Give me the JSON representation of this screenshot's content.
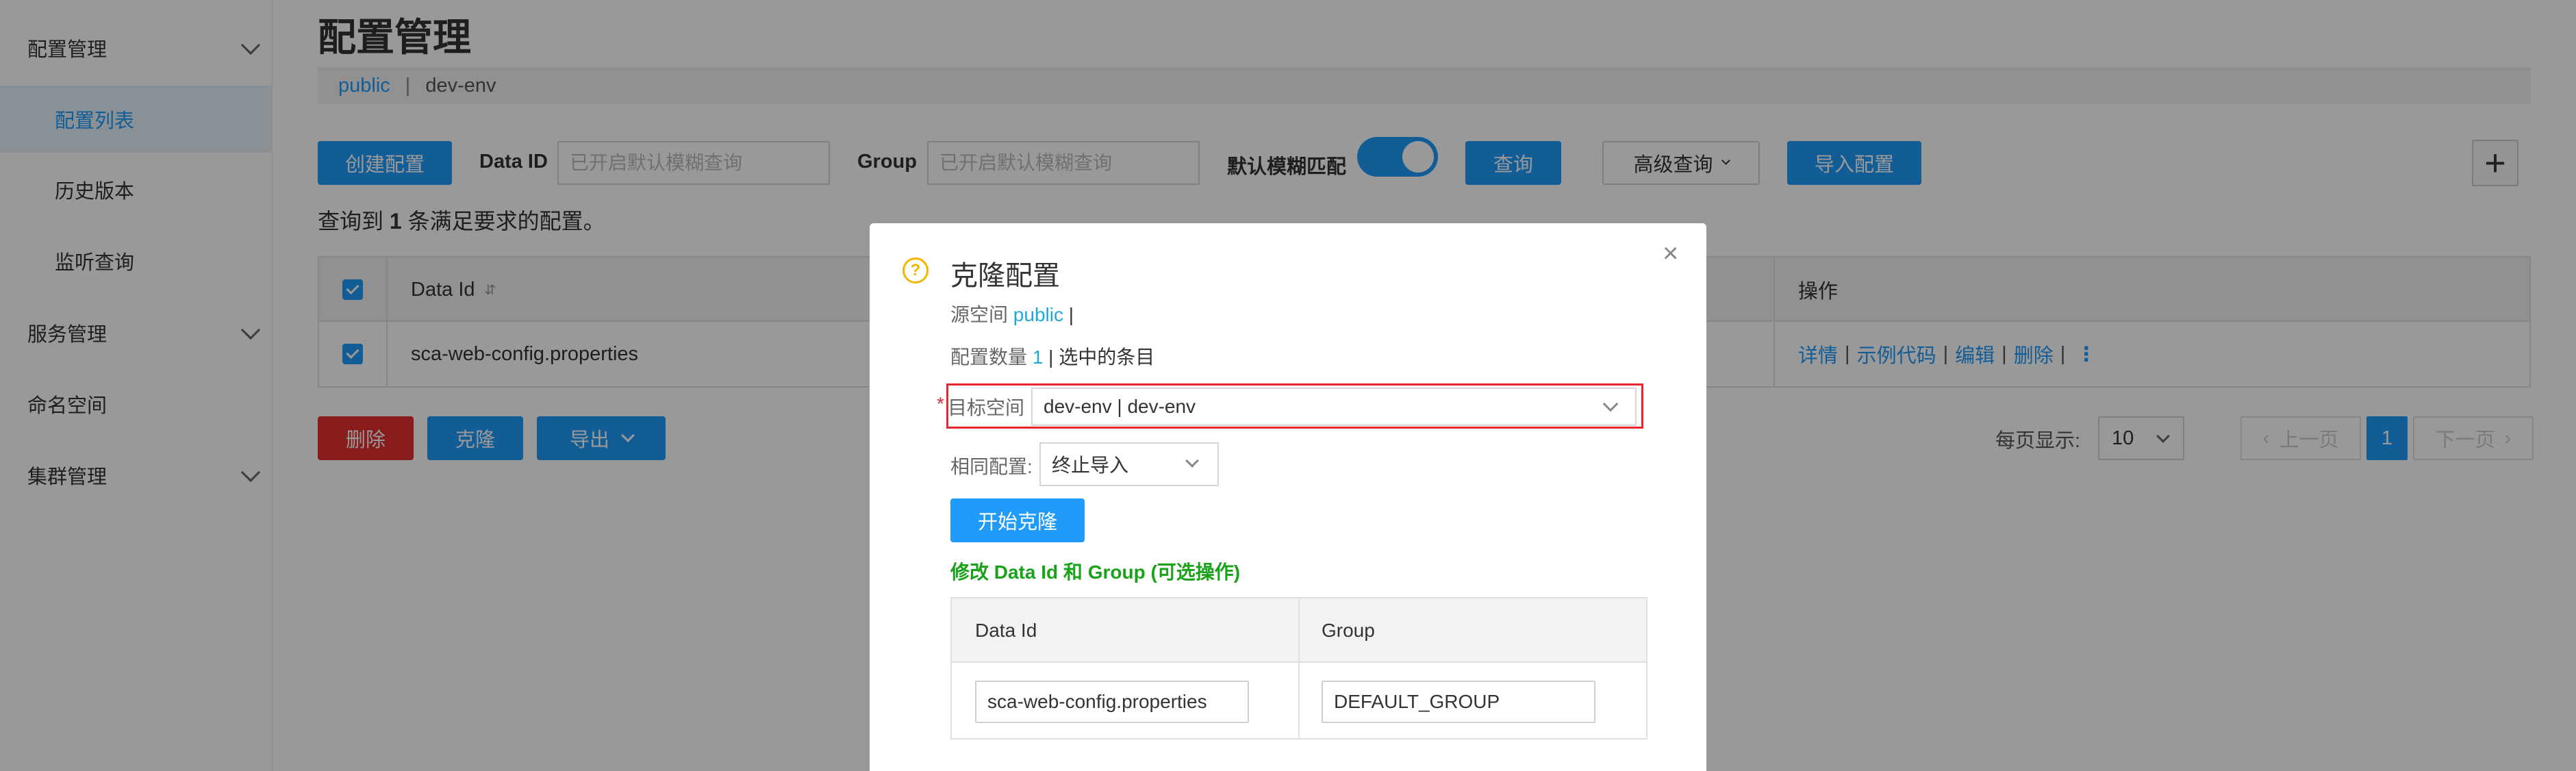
{
  "sidebar": {
    "groups": [
      {
        "label": "配置管理"
      },
      {
        "label": "服务管理"
      },
      {
        "label": "命名空间"
      },
      {
        "label": "集群管理"
      }
    ],
    "items": [
      {
        "label": "配置列表"
      },
      {
        "label": "历史版本"
      },
      {
        "label": "监听查询"
      }
    ]
  },
  "header": {
    "title": "配置管理",
    "breadcrumb": {
      "link": "public",
      "separator": "|",
      "current": "dev-env"
    }
  },
  "toolbar": {
    "create_label": "创建配置",
    "dataid_label": "Data ID",
    "dataid_placeholder": "已开启默认模糊查询",
    "group_label": "Group",
    "group_placeholder": "已开启默认模糊查询",
    "fuzzy_label": "默认模糊匹配",
    "fuzzy_on": true,
    "query_label": "查询",
    "advanced_label": "高级查询",
    "import_label": "导入配置",
    "plus": "+"
  },
  "result": {
    "prefix": "查询到",
    "count": "1",
    "suffix": "条满足要求的配置。"
  },
  "table": {
    "headers": {
      "dataid": "Data Id",
      "sort_icon": "⇵",
      "ops": "操作"
    },
    "rows": [
      {
        "dataid": "sca-web-config.properties",
        "ops": [
          "详情",
          "示例代码",
          "编辑",
          "删除"
        ],
        "more": "⋮"
      }
    ]
  },
  "actions": {
    "delete_label": "删除",
    "clone_label": "克隆",
    "export_label": "导出"
  },
  "pagination": {
    "page_size_label": "每页显示:",
    "page_size": "10",
    "prev": "上一页",
    "current": "1",
    "next": "下一页"
  },
  "dialog": {
    "icon": "?",
    "title": "克隆配置",
    "close": "×",
    "source_label": "源空间",
    "source_value": "public",
    "source_suffix": "|",
    "count_label": "配置数量",
    "count_value": "1",
    "count_suffix": "| 选中的条目",
    "target_label": "目标空间",
    "target_value": "dev-env | dev-env",
    "same_label": "相同配置:",
    "same_value": "终止导入",
    "start_label": "开始克隆",
    "note": "修改 Data Id 和 Group (可选操作)",
    "table": {
      "headers": {
        "dataid": "Data Id",
        "group": "Group"
      },
      "row": {
        "dataid": "sca-web-config.properties",
        "group": "DEFAULT_GROUP"
      }
    }
  },
  "colors": {
    "primary": "#209bfa",
    "danger": "#e32d2d",
    "note_green": "#1aa31a",
    "highlight_red": "#e8262e"
  }
}
